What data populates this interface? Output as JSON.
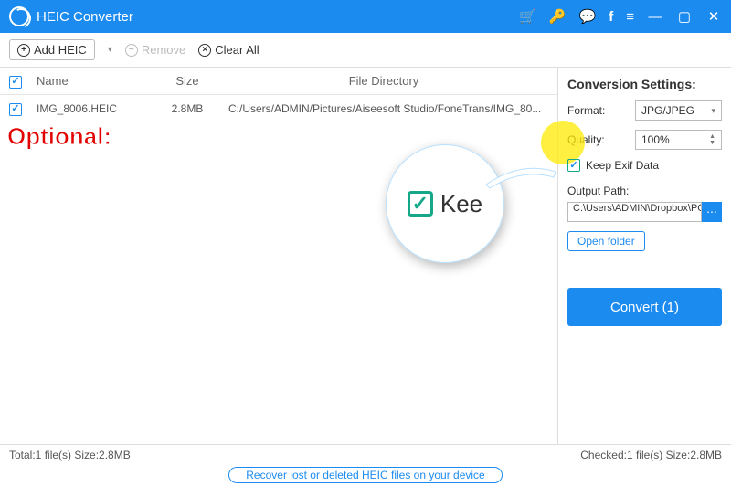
{
  "app": {
    "title": "HEIC Converter"
  },
  "toolbar": {
    "add_label": "Add HEIC",
    "remove_label": "Remove",
    "clear_label": "Clear All"
  },
  "columns": {
    "name": "Name",
    "size": "Size",
    "dir": "File Directory"
  },
  "files": [
    {
      "name": "IMG_8006.HEIC",
      "size": "2.8MB",
      "dir": "C:/Users/ADMIN/Pictures/Aiseesoft Studio/FoneTrans/IMG_80..."
    }
  ],
  "annotation": {
    "optional": "Optional:"
  },
  "zoom": {
    "text": "Kee"
  },
  "settings": {
    "title": "Conversion Settings:",
    "format_label": "Format:",
    "format_value": "JPG/JPEG",
    "quality_label": "Quality:",
    "quality_value": "100%",
    "keep_exif": "Keep Exif Data",
    "output_label": "Output Path:",
    "output_value": "C:\\Users\\ADMIN\\Dropbox\\PC\\",
    "open_folder": "Open folder",
    "convert": "Convert (1)"
  },
  "status": {
    "left": "Total:1 file(s) Size:2.8MB",
    "right": "Checked:1 file(s) Size:2.8MB"
  },
  "footer": {
    "recover": "Recover lost or deleted HEIC files on your device"
  }
}
